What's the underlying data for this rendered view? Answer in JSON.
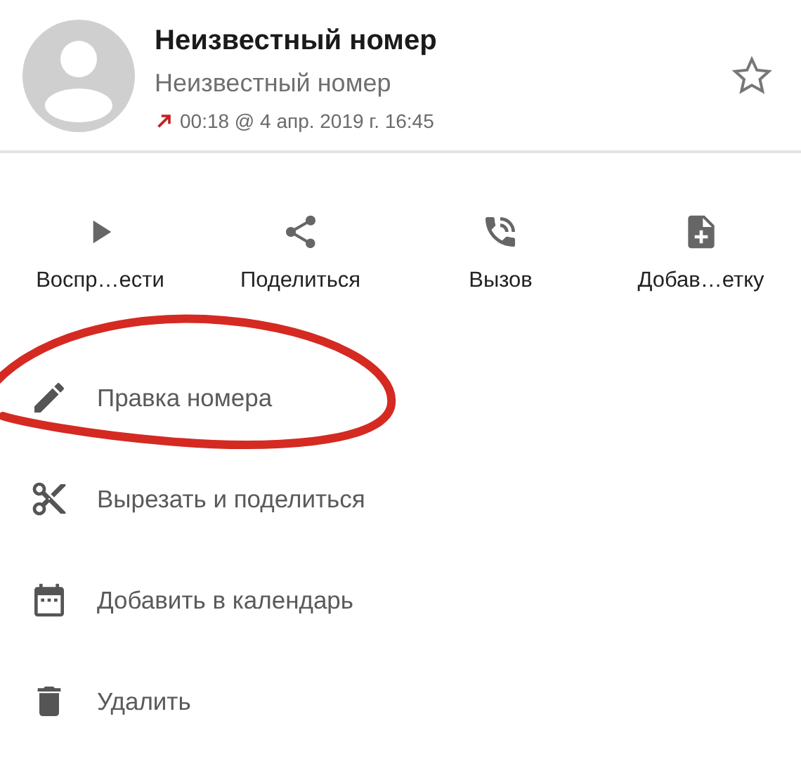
{
  "header": {
    "title": "Неизвестный номер",
    "subtitle": "Неизвестный номер",
    "call_icon": {
      "kind": "outgoing"
    },
    "details": "00:18 @ 4 апр. 2019 г. 16:45",
    "starred": false
  },
  "actions": [
    {
      "kind": "play",
      "label": "Воспр…ести"
    },
    {
      "kind": "share",
      "label": "Поделиться"
    },
    {
      "kind": "call",
      "label": "Вызов"
    },
    {
      "kind": "note",
      "label": "Добав…етку"
    }
  ],
  "menu": [
    {
      "kind": "edit",
      "label": "Правка номера"
    },
    {
      "kind": "cut",
      "label": "Вырезать и поделиться"
    },
    {
      "kind": "calendar",
      "label": "Добавить в календарь"
    },
    {
      "kind": "delete",
      "label": "Удалить"
    }
  ]
}
